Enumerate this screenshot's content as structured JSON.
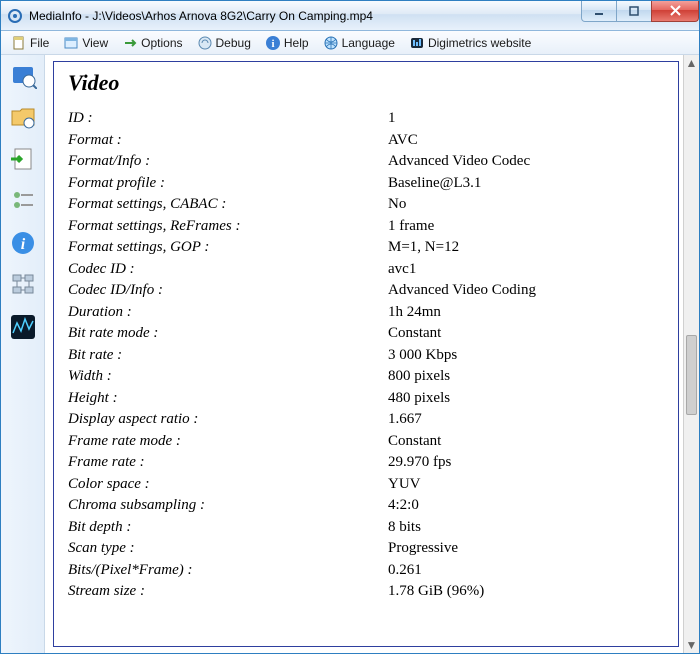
{
  "window": {
    "title": "MediaInfo - J:\\Videos\\Arhos Arnova 8G2\\Carry On Camping.mp4"
  },
  "menu": {
    "file": "File",
    "view": "View",
    "options": "Options",
    "debug": "Debug",
    "help": "Help",
    "language": "Language",
    "digimetrics": "Digimetrics website"
  },
  "section": {
    "title": "Video"
  },
  "rows": [
    {
      "key": "ID :",
      "val": "1"
    },
    {
      "key": "Format :",
      "val": "AVC"
    },
    {
      "key": "Format/Info :",
      "val": "Advanced Video Codec"
    },
    {
      "key": "Format profile :",
      "val": "Baseline@L3.1"
    },
    {
      "key": "Format settings, CABAC :",
      "val": "No"
    },
    {
      "key": "Format settings, ReFrames :",
      "val": "1 frame"
    },
    {
      "key": "Format settings, GOP :",
      "val": "M=1, N=12"
    },
    {
      "key": "Codec ID :",
      "val": "avc1"
    },
    {
      "key": "Codec ID/Info :",
      "val": "Advanced Video Coding"
    },
    {
      "key": "Duration :",
      "val": "1h 24mn"
    },
    {
      "key": "Bit rate mode :",
      "val": "Constant"
    },
    {
      "key": "Bit rate :",
      "val": "3 000 Kbps"
    },
    {
      "key": "Width :",
      "val": "800 pixels"
    },
    {
      "key": "Height :",
      "val": "480 pixels"
    },
    {
      "key": "Display aspect ratio :",
      "val": "1.667"
    },
    {
      "key": "Frame rate mode :",
      "val": "Constant"
    },
    {
      "key": "Frame rate :",
      "val": "29.970 fps"
    },
    {
      "key": "Color space :",
      "val": "YUV"
    },
    {
      "key": "Chroma subsampling :",
      "val": "4:2:0"
    },
    {
      "key": "Bit depth :",
      "val": "8 bits"
    },
    {
      "key": "Scan type :",
      "val": "Progressive"
    },
    {
      "key": "Bits/(Pixel*Frame) :",
      "val": "0.261"
    },
    {
      "key": "Stream size :",
      "val": "1.78 GiB (96%)"
    }
  ]
}
